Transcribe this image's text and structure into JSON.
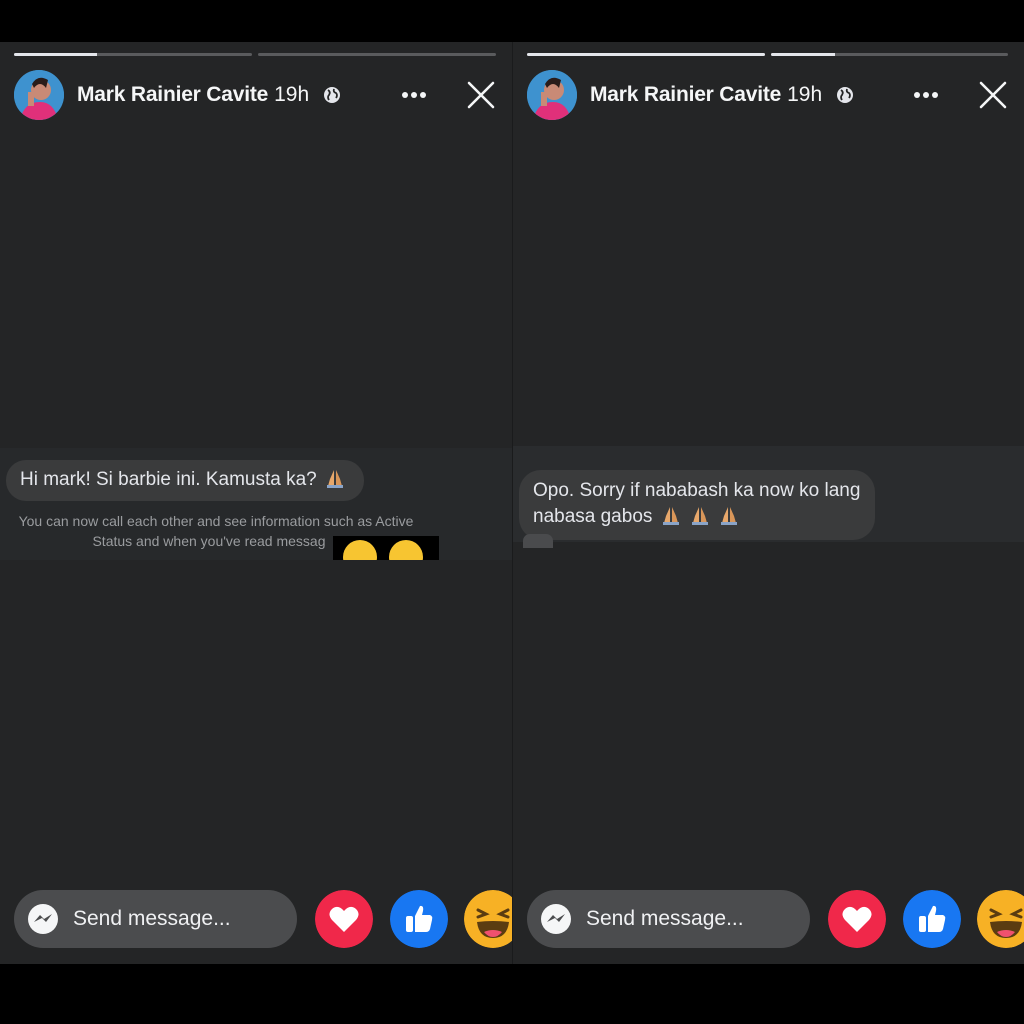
{
  "stories": [
    {
      "author": "Mark Rainier Cavite",
      "time": "19h",
      "privacy_icon": "globe-icon",
      "progress": [
        0.35,
        0
      ],
      "message": "Hi mark! Si barbie ini. Kamusta ka?",
      "info_line1": "You can now call each other and see information such as Active",
      "info_line2": "Status and when you've read messag",
      "send_placeholder": "Send message..."
    },
    {
      "author": "Mark Rainier Cavite",
      "time": "19h",
      "privacy_icon": "globe-icon",
      "progress": [
        1,
        0.27
      ],
      "message_line1": "Opo. Sorry if nababash ka now ko lang",
      "message_line2": "nabasa gabos",
      "send_placeholder": "Send message..."
    }
  ],
  "colors": {
    "background": "#242526",
    "bubble": "#3a3b3c",
    "heart": "#f0284a",
    "like": "#1877f2",
    "haha": "#f7b125"
  }
}
